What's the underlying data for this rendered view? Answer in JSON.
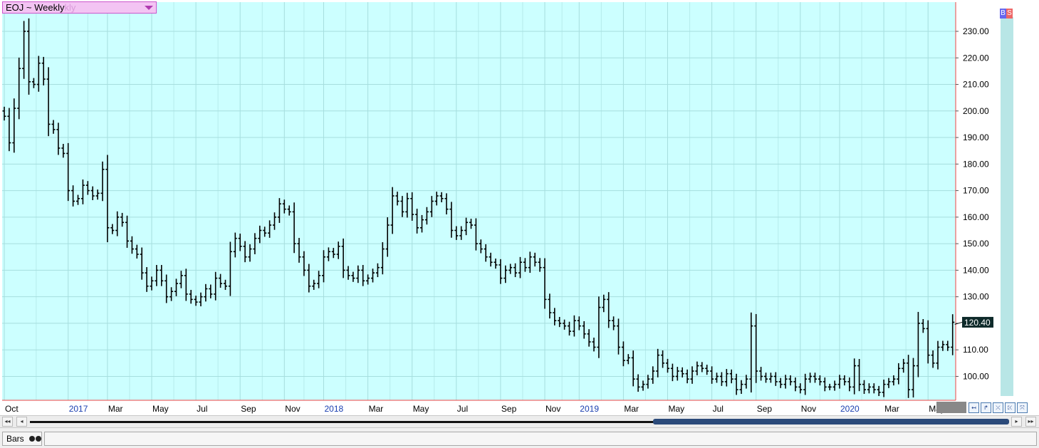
{
  "symbol_selector": {
    "label": "EOJ ~ Weekly",
    "ghost_text": "kly"
  },
  "buy_sell": {
    "buy": "B",
    "sell": "S"
  },
  "last_price_label": "120.40",
  "nav_buttons": [
    "↤",
    "↱",
    "⤫",
    "⤪",
    "⤧"
  ],
  "scroll_buttons": {
    "left_far": "◂◂",
    "left": "◂",
    "right": "▸",
    "right_far": "▸▸"
  },
  "status_bar": {
    "chart_type_label": "Bars"
  },
  "colors": {
    "plot_bg": "#ccffff",
    "grid": "#a6dede",
    "bars": "#000000",
    "axis_line": "#ee4444",
    "year_label": "#1a3fb0",
    "price_tag_bg": "#0e2a2a",
    "right_strip": "#b8e6e6"
  },
  "chart_data": {
    "type": "bar",
    "title": "EOJ ~ Weekly",
    "subtype": "ohlc",
    "xlabel": "",
    "ylabel": "",
    "ylim": [
      91,
      241
    ],
    "y_ticks": [
      100,
      110,
      120,
      130,
      140,
      150,
      160,
      170,
      180,
      190,
      200,
      210,
      220,
      230
    ],
    "y_tick_labels": [
      "100.00",
      "110.00",
      "120.00",
      "130.00",
      "140.00",
      "150.00",
      "160.00",
      "170.00",
      "180.00",
      "190.00",
      "200.00",
      "210.00",
      "220.00",
      "230.00"
    ],
    "x_tick_labels": [
      {
        "label": "Oct",
        "week": 0,
        "year": false
      },
      {
        "label": "2017",
        "week": 13,
        "year": true
      },
      {
        "label": "Mar",
        "week": 21,
        "year": false
      },
      {
        "label": "May",
        "week": 30,
        "year": false
      },
      {
        "label": "Jul",
        "week": 39,
        "year": false
      },
      {
        "label": "Sep",
        "week": 48,
        "year": false
      },
      {
        "label": "Nov",
        "week": 57,
        "year": false
      },
      {
        "label": "2018",
        "week": 65,
        "year": true
      },
      {
        "label": "Mar",
        "week": 74,
        "year": false
      },
      {
        "label": "May",
        "week": 83,
        "year": false
      },
      {
        "label": "Jul",
        "week": 92,
        "year": false
      },
      {
        "label": "Sep",
        "week": 101,
        "year": false
      },
      {
        "label": "Nov",
        "week": 110,
        "year": false
      },
      {
        "label": "2019",
        "week": 117,
        "year": true
      },
      {
        "label": "Mar",
        "week": 126,
        "year": false
      },
      {
        "label": "May",
        "week": 135,
        "year": false
      },
      {
        "label": "Jul",
        "week": 144,
        "year": false
      },
      {
        "label": "Sep",
        "week": 153,
        "year": false
      },
      {
        "label": "Nov",
        "week": 162,
        "year": false
      },
      {
        "label": "2020",
        "week": 170,
        "year": true
      },
      {
        "label": "Mar",
        "week": 179,
        "year": false
      },
      {
        "label": "May",
        "week": 188,
        "year": false
      }
    ],
    "last_value": 120.4,
    "grid": true,
    "weekly_closes": [
      198,
      188,
      201,
      216,
      230,
      211,
      210,
      218,
      212,
      195,
      193,
      186,
      184,
      170,
      166,
      167,
      172,
      170,
      168,
      169,
      178,
      156,
      155,
      160,
      158,
      151,
      148,
      146,
      139,
      134,
      136,
      140,
      136,
      130,
      132,
      135,
      138,
      131,
      129,
      128,
      130,
      133,
      131,
      137,
      135,
      134,
      147,
      152,
      149,
      145,
      148,
      152,
      155,
      154,
      157,
      160,
      165,
      163,
      162,
      150,
      145,
      140,
      134,
      135,
      138,
      145,
      147,
      146,
      149,
      140,
      138,
      137,
      140,
      136,
      137,
      139,
      141,
      148,
      157,
      168,
      166,
      162,
      167,
      161,
      156,
      159,
      162,
      166,
      168,
      167,
      163,
      155,
      153,
      155,
      158,
      157,
      150,
      148,
      145,
      143,
      142,
      137,
      140,
      141,
      139,
      143,
      141,
      145,
      143,
      141,
      129,
      124,
      121,
      120,
      119,
      117,
      121,
      119,
      116,
      113,
      111,
      126,
      129,
      121,
      119,
      111,
      106,
      107,
      99,
      96,
      97,
      99,
      102,
      108,
      105,
      103,
      100,
      102,
      101,
      99,
      102,
      104,
      103,
      102,
      99,
      100,
      98,
      101,
      99,
      95,
      97,
      99,
      119,
      102,
      100,
      99,
      100,
      98,
      97,
      99,
      98,
      96,
      95,
      99,
      100,
      99,
      98,
      96,
      96,
      97,
      99,
      98,
      96,
      104,
      97,
      95,
      96,
      95,
      94,
      97,
      98,
      99,
      103,
      105,
      95,
      104,
      120,
      118,
      108,
      105,
      111,
      112,
      111,
      120.4
    ]
  }
}
